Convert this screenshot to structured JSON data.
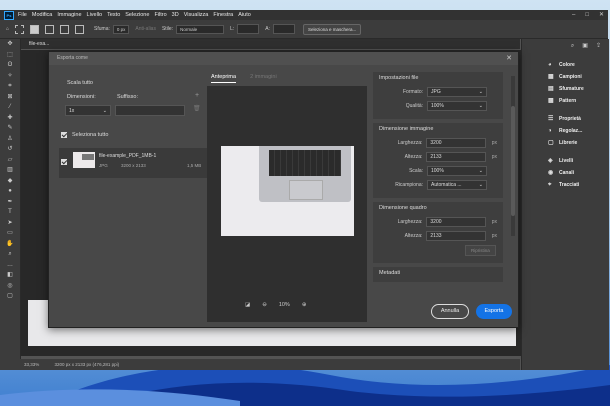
{
  "menubar": {
    "logo": "Ps",
    "items": [
      "File",
      "Modifica",
      "Immagine",
      "Livello",
      "Testo",
      "Selezione",
      "Filtro",
      "3D",
      "Visualizza",
      "Finestra",
      "Aiuto"
    ],
    "window_controls": [
      "–",
      "□",
      "✕"
    ]
  },
  "options_bar": {
    "sfuma_label": "Sfuma:",
    "sfuma_value": "0 px",
    "antialias": "Anti-alias",
    "stile_label": "Stile:",
    "stile_value": "Normale",
    "l_label": "L:",
    "a_label": "A:",
    "select_mask": "Seleziona e maschera..."
  },
  "document": {
    "tab": "file-exa..."
  },
  "status": {
    "zoom": "33,33%",
    "info": "3200 px x 2133 px (476,281 ppi)"
  },
  "right_panels": {
    "group1": [
      "Colore",
      "Campioni",
      "Sfumature",
      "Pattern"
    ],
    "group2": [
      "Proprietà",
      "Regolaz...",
      "Librerie"
    ],
    "group3": [
      "Livelli",
      "Canali",
      "Tracciati"
    ]
  },
  "dialog": {
    "title": "Esporta come",
    "scale_all": "Scala tutto",
    "dims_label": "Dimensioni:",
    "suffix_label": "Suffisso:",
    "scale_value": "1x",
    "select_all": "Seleziona tutto",
    "file": {
      "name": "file-example_PDF_1MB-1",
      "format": "JPG",
      "dims": "3200 x 2133",
      "size": "1,5 MB"
    },
    "tabs": {
      "preview": "Anteprima",
      "images": "2 immagini"
    },
    "zoom_value": "10%",
    "settings": {
      "file_header": "Impostazioni file",
      "format_label": "Formato:",
      "format_value": "JPG",
      "quality_label": "Qualità:",
      "quality_value": "100%",
      "image_header": "Dimensione immagine",
      "width_label": "Larghezza:",
      "width_value": "3200",
      "height_label": "Altezza:",
      "height_value": "2133",
      "scale_label": "Scala:",
      "scale_value": "100%",
      "resample_label": "Ricampiona:",
      "resample_value": "Automatica ...",
      "unit": "px",
      "canvas_header": "Dimensione quadro",
      "canvas_width_value": "3200",
      "canvas_height_value": "2133",
      "reset": "Ripristina",
      "metadata_header": "Metadati"
    },
    "cancel": "Annulla",
    "export": "Esporta"
  }
}
